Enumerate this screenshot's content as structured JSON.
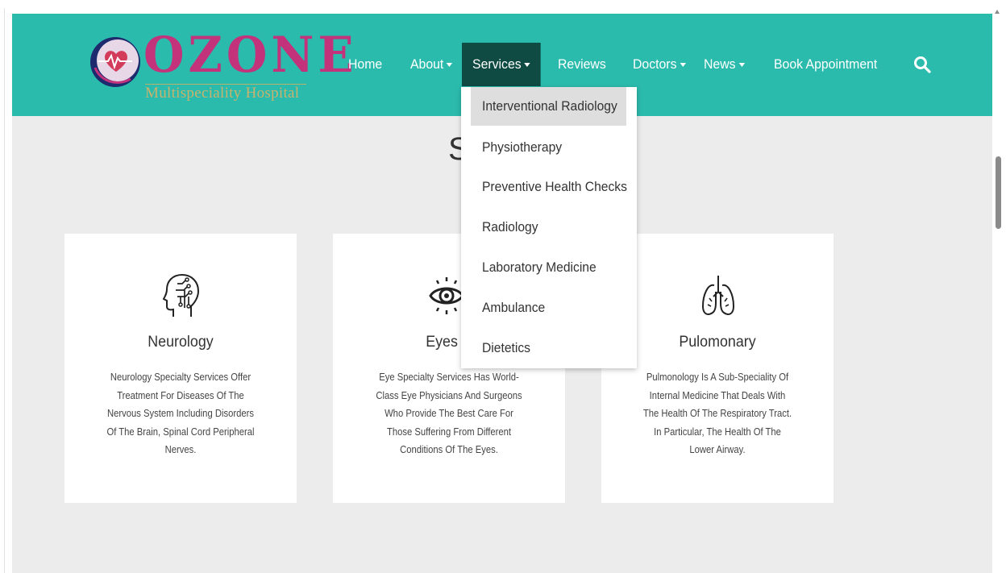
{
  "logo": {
    "word": "OZONE",
    "subtitle": "Multispeciality Hospital"
  },
  "nav": {
    "items": [
      {
        "label": "Home",
        "has_caret": false
      },
      {
        "label": "About",
        "has_caret": true
      },
      {
        "label": "Services",
        "has_caret": true,
        "active": true
      },
      {
        "label": "Reviews",
        "has_caret": false
      },
      {
        "label": "Doctors",
        "has_caret": true
      },
      {
        "label": "News",
        "has_caret": true
      },
      {
        "label": "Book Appointment",
        "has_caret": false
      }
    ],
    "search_icon": "search-icon"
  },
  "dropdown": {
    "items": [
      {
        "label": "Interventional Radiology",
        "hovered": true
      },
      {
        "label": "Physiotherapy"
      },
      {
        "label": "Preventive Health Checks"
      },
      {
        "label": "Radiology"
      },
      {
        "label": "Laboratory Medicine"
      },
      {
        "label": "Ambulance"
      },
      {
        "label": "Dietetics"
      }
    ]
  },
  "section": {
    "title_visible": "S"
  },
  "cards": [
    {
      "icon": "brain-icon",
      "title": "Neurology",
      "desc": "Neurology Specialty Services Offer Treatment For Diseases Of The Nervous System Including Disorders Of The Brain, Spinal Cord Peripheral Nerves."
    },
    {
      "icon": "eye-icon",
      "title": "Eyes C",
      "desc": "Eye Specialty Services Has World-Class Eye Physicians And Surgeons Who Provide The Best Care For Those Suffering From Different Conditions Of The Eyes."
    },
    {
      "icon": "lungs-icon",
      "title": "Pulomonary",
      "desc": "Pulmonology Is A Sub-Speciality Of Internal Medicine That Deals With The Health Of The Respiratory Tract. In Particular, The Health Of The Lower Airway."
    }
  ],
  "colors": {
    "navbar": "#2bbbad",
    "nav_active": "#0f4a43",
    "logo_word": "#c2337c",
    "logo_subtitle": "#c9b36c",
    "page_bg": "#ececec",
    "dropdown_hover": "#dedede"
  }
}
